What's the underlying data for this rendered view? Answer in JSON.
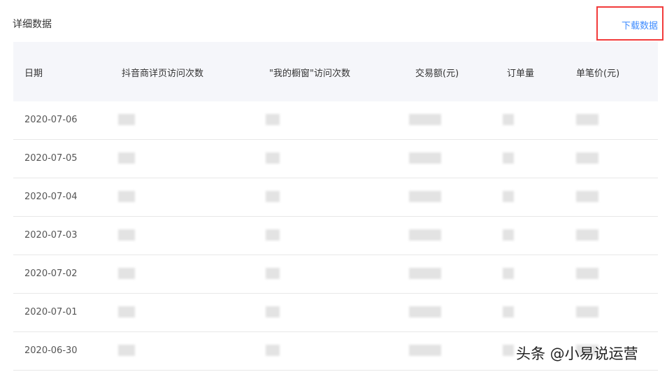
{
  "section_title": "详细数据",
  "download_label": "下载数据",
  "columns": [
    "日期",
    "抖音商详页访问次数",
    "\"我的橱窗\"访问次数",
    "交易额(元)",
    "订单量",
    "单笔价(元)"
  ],
  "rows": [
    {
      "date": "2020-07-06"
    },
    {
      "date": "2020-07-05"
    },
    {
      "date": "2020-07-04"
    },
    {
      "date": "2020-07-03"
    },
    {
      "date": "2020-07-02"
    },
    {
      "date": "2020-07-01"
    },
    {
      "date": "2020-06-30"
    }
  ],
  "watermark": "头条 @小易说运营",
  "colors": {
    "accent": "#3f8cff",
    "highlight_box": "#f23b3b",
    "header_bg": "#f5f6fa"
  }
}
